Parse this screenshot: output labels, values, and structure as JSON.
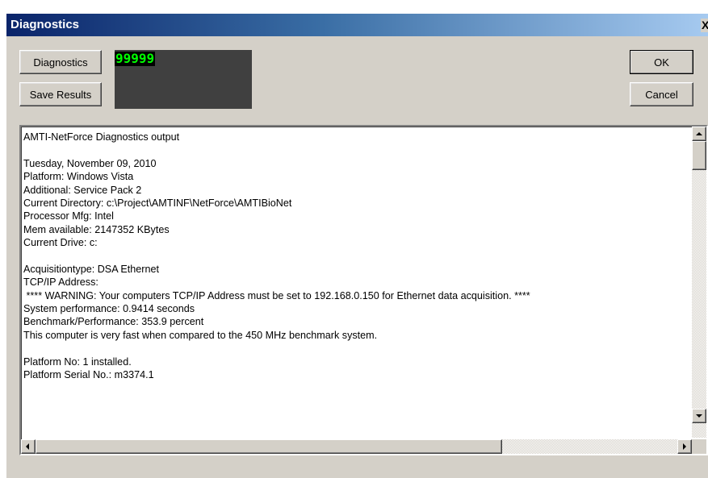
{
  "window": {
    "title": "Diagnostics",
    "close_glyph": "X"
  },
  "buttons": {
    "diagnostics_label": "Diagnostics",
    "save_results_label": "Save Results",
    "ok_label": "OK",
    "cancel_label": "Cancel"
  },
  "display": {
    "value": "99999",
    "text_color": "#00ff00",
    "background_color": "#404040"
  },
  "output": {
    "lines": [
      "AMTI-NetForce Diagnostics output",
      "",
      "Tuesday, November 09, 2010",
      "Platform: Windows Vista",
      "Additional: Service Pack 2",
      "Current Directory: c:\\Project\\AMTINF\\NetForce\\AMTIBioNet",
      "Processor Mfg: Intel",
      "Mem available: 2147352 KBytes",
      "Current Drive: c:",
      "",
      "Acquisitiontype: DSA Ethernet",
      "TCP/IP Address:",
      " **** WARNING: Your computers TCP/IP Address must be set to 192.168.0.150 for Ethernet data acquisition. ****",
      "System performance: 0.9414 seconds",
      "Benchmark/Performance: 353.9 percent",
      "This computer is very fast when compared to the 450 MHz benchmark system.",
      "",
      "Platform No: 1 installed.",
      "Platform Serial No.: m3374.1"
    ]
  },
  "scrollbars": {
    "vertical_position": 0.0,
    "horizontal_position": 0.0
  },
  "icons": {
    "scroll_up": "scroll-up-arrow-icon",
    "scroll_down": "scroll-down-arrow-icon",
    "scroll_left": "scroll-left-arrow-icon",
    "scroll_right": "scroll-right-arrow-icon"
  },
  "colors": {
    "titlebar_start": "#0a246a",
    "titlebar_end": "#a6caf0",
    "dialog_face": "#d4d0c8"
  }
}
